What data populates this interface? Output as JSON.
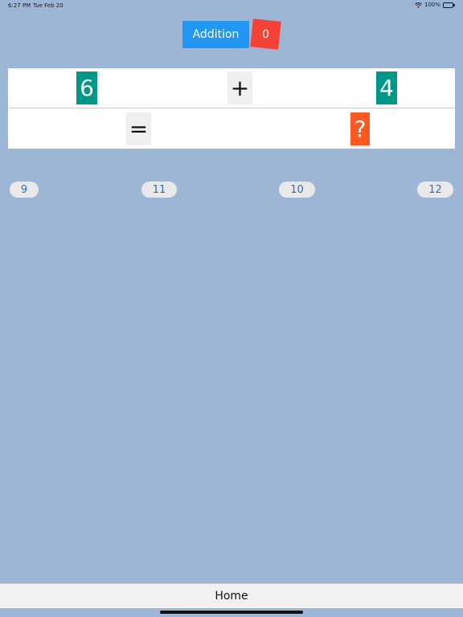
{
  "status_bar": {
    "time": "6:27 PM",
    "date": "Tue Feb 20",
    "battery": "100%",
    "wifi_icon": "wifi-icon",
    "battery_icon": "battery-icon"
  },
  "header": {
    "mode_label": "Addition",
    "score": "0",
    "colors": {
      "mode_button": "#2196f3",
      "score_badge": "#f44336"
    }
  },
  "equation": {
    "operand_a": "6",
    "operator": "+",
    "operand_b": "4",
    "equals": "=",
    "answer": "?",
    "colors": {
      "operand": "#009688",
      "answer": "#ff5722",
      "operator_bg": "#efefef"
    }
  },
  "choices": [
    "9",
    "11",
    "10",
    "12"
  ],
  "tabbar": {
    "home_label": "Home"
  },
  "colors": {
    "background": "#9db6d5"
  }
}
